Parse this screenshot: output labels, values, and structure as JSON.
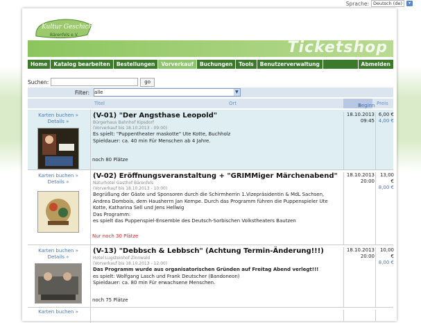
{
  "language": {
    "label": "Sprache:",
    "selected": "Deutsch (de)"
  },
  "logo": {
    "line1": "Kultur Geschichte",
    "line2": "Bärenfels e.V."
  },
  "banner": {
    "title": "Ticketshop"
  },
  "nav": {
    "home": "Home",
    "catalog": "Katalog bearbeiten",
    "orders": "Bestellungen",
    "presale": "Vorverkauf",
    "bookings": "Buchungen",
    "tools": "Tools",
    "users": "Benutzerverwaltung",
    "logout": "Abmelden"
  },
  "search": {
    "label": "Suchen:",
    "value": "",
    "button": "go"
  },
  "filter": {
    "label": "Filter:",
    "selected": "alle"
  },
  "columns": {
    "title": "Titel",
    "location": "Ort",
    "begin": "Beginn",
    "price": "Preis"
  },
  "events": [
    {
      "book": "Karten buchen »",
      "details": "Details »",
      "title": "(V-01) \"Der Angsthase Leopold\"",
      "venue": "Bürgerhaus Bahnhof Kipsdorf",
      "presale": "(Vorverkauf bis 18.10.2013 - 09:00)",
      "lines": [
        "Es spielt: \"Puppentheater maskotte\" Ute Kotte, Buchholz",
        "Spieldauer: ca. 40 min     Für Menschen ab 4 Jahre."
      ],
      "places": "noch 80 Plätze",
      "date": "18.10.2013",
      "time": "09:45",
      "price1": "6,00 €",
      "price2": "4,00 €"
    },
    {
      "book": "Karten buchen »",
      "details": "Details »",
      "title": "(V-02) Eröffnungsveranstaltung + \"GRIMMiger Märchenabend\"",
      "venue": "Naturhotel Gasthof Bärenfels",
      "presale": "(Vorverkauf bis 18.10.2013 - 10:00)",
      "lines": [
        "Begrüßung der Gäste und Sponsoren durch die Schirmherrin 1.Vizepräsidentin & MdL Sachsen, Andrea Dombois, dem Hausherrn Jan Kempe. Durch das Programm führen die Puppenspieler Ute Kotte, Katharina Sell und Jens Hellwig",
        "Das Programm:",
        "es spielt das Puppenspiel-Ensemble des Deutsch-Sorbischen Volkstheaters Bautzen"
      ],
      "places": "Nur noch 30 Plätze",
      "date": "18.10.2013",
      "time": "20:00",
      "price1": "13,00 €",
      "price2": "8,00 €"
    },
    {
      "book": "Karten buchen »",
      "details": "Details »",
      "title": "(V-13) \"Debbsch & Lebbsch\" (Achtung Termin-Änderung!!!)",
      "venue": "Hotel Lugsteinhof Zinnwald",
      "presale": "(Vorverkauf bis 18.10.2013 - 12:00)",
      "bold_line": "Das Programm wurde aus organisatorischen Gründen auf Freitag Abend verlegt!!!",
      "lines": [
        "es spielt: Wolfgang Lasch und Frank Deutscher (Bandoneon)",
        "Spieldauer: ca. 80 min     Für erwachsene Menschen."
      ],
      "places": "noch 75 Plätze",
      "date": "18.10.2013",
      "time": "20:00",
      "price1": "10,00 €",
      "price2": "8,00 €"
    },
    {
      "book": "Karten buchen »"
    }
  ],
  "colors": {
    "nav_bg": "#3a7a2a",
    "nav_active": "#8ec56b",
    "banner": "#8cc55e",
    "link": "#4e77b5",
    "alert": "#e02020"
  }
}
